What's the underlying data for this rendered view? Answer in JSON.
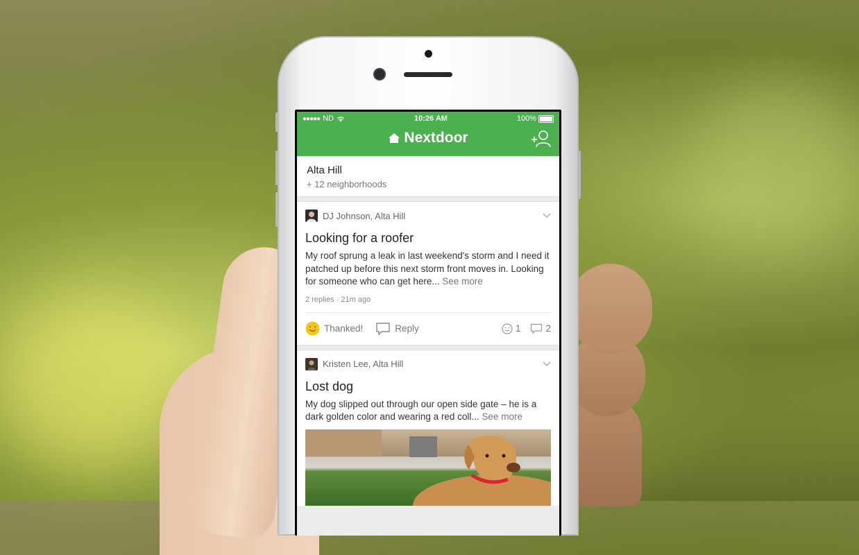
{
  "status_bar": {
    "carrier": "ND",
    "time": "10:26 AM",
    "battery": "100%"
  },
  "app": {
    "brand": "Nextdoor"
  },
  "neighborhood": {
    "name": "Alta Hill",
    "sub": "+ 12 neighborhoods"
  },
  "posts": [
    {
      "author": "DJ Johnson, Alta Hill",
      "title": "Looking for a roofer",
      "body": "My roof sprung a leak in last weekend's storm and I need it patched up before this next storm front moves in. Looking for someone who can get here...",
      "see_more": "See more",
      "meta": "2 replies · 21m ago",
      "thank_label": "Thanked!",
      "reply_label": "Reply",
      "thanks_count": "1",
      "reply_count": "2"
    },
    {
      "author": "Kristen Lee, Alta Hill",
      "title": "Lost dog",
      "body": "My dog slipped out through our open side gate – he is a dark golden color and wearing a red coll...",
      "see_more": "See more"
    }
  ],
  "colors": {
    "brand_green": "#4caf50",
    "thanked_yellow": "#f5c518"
  }
}
